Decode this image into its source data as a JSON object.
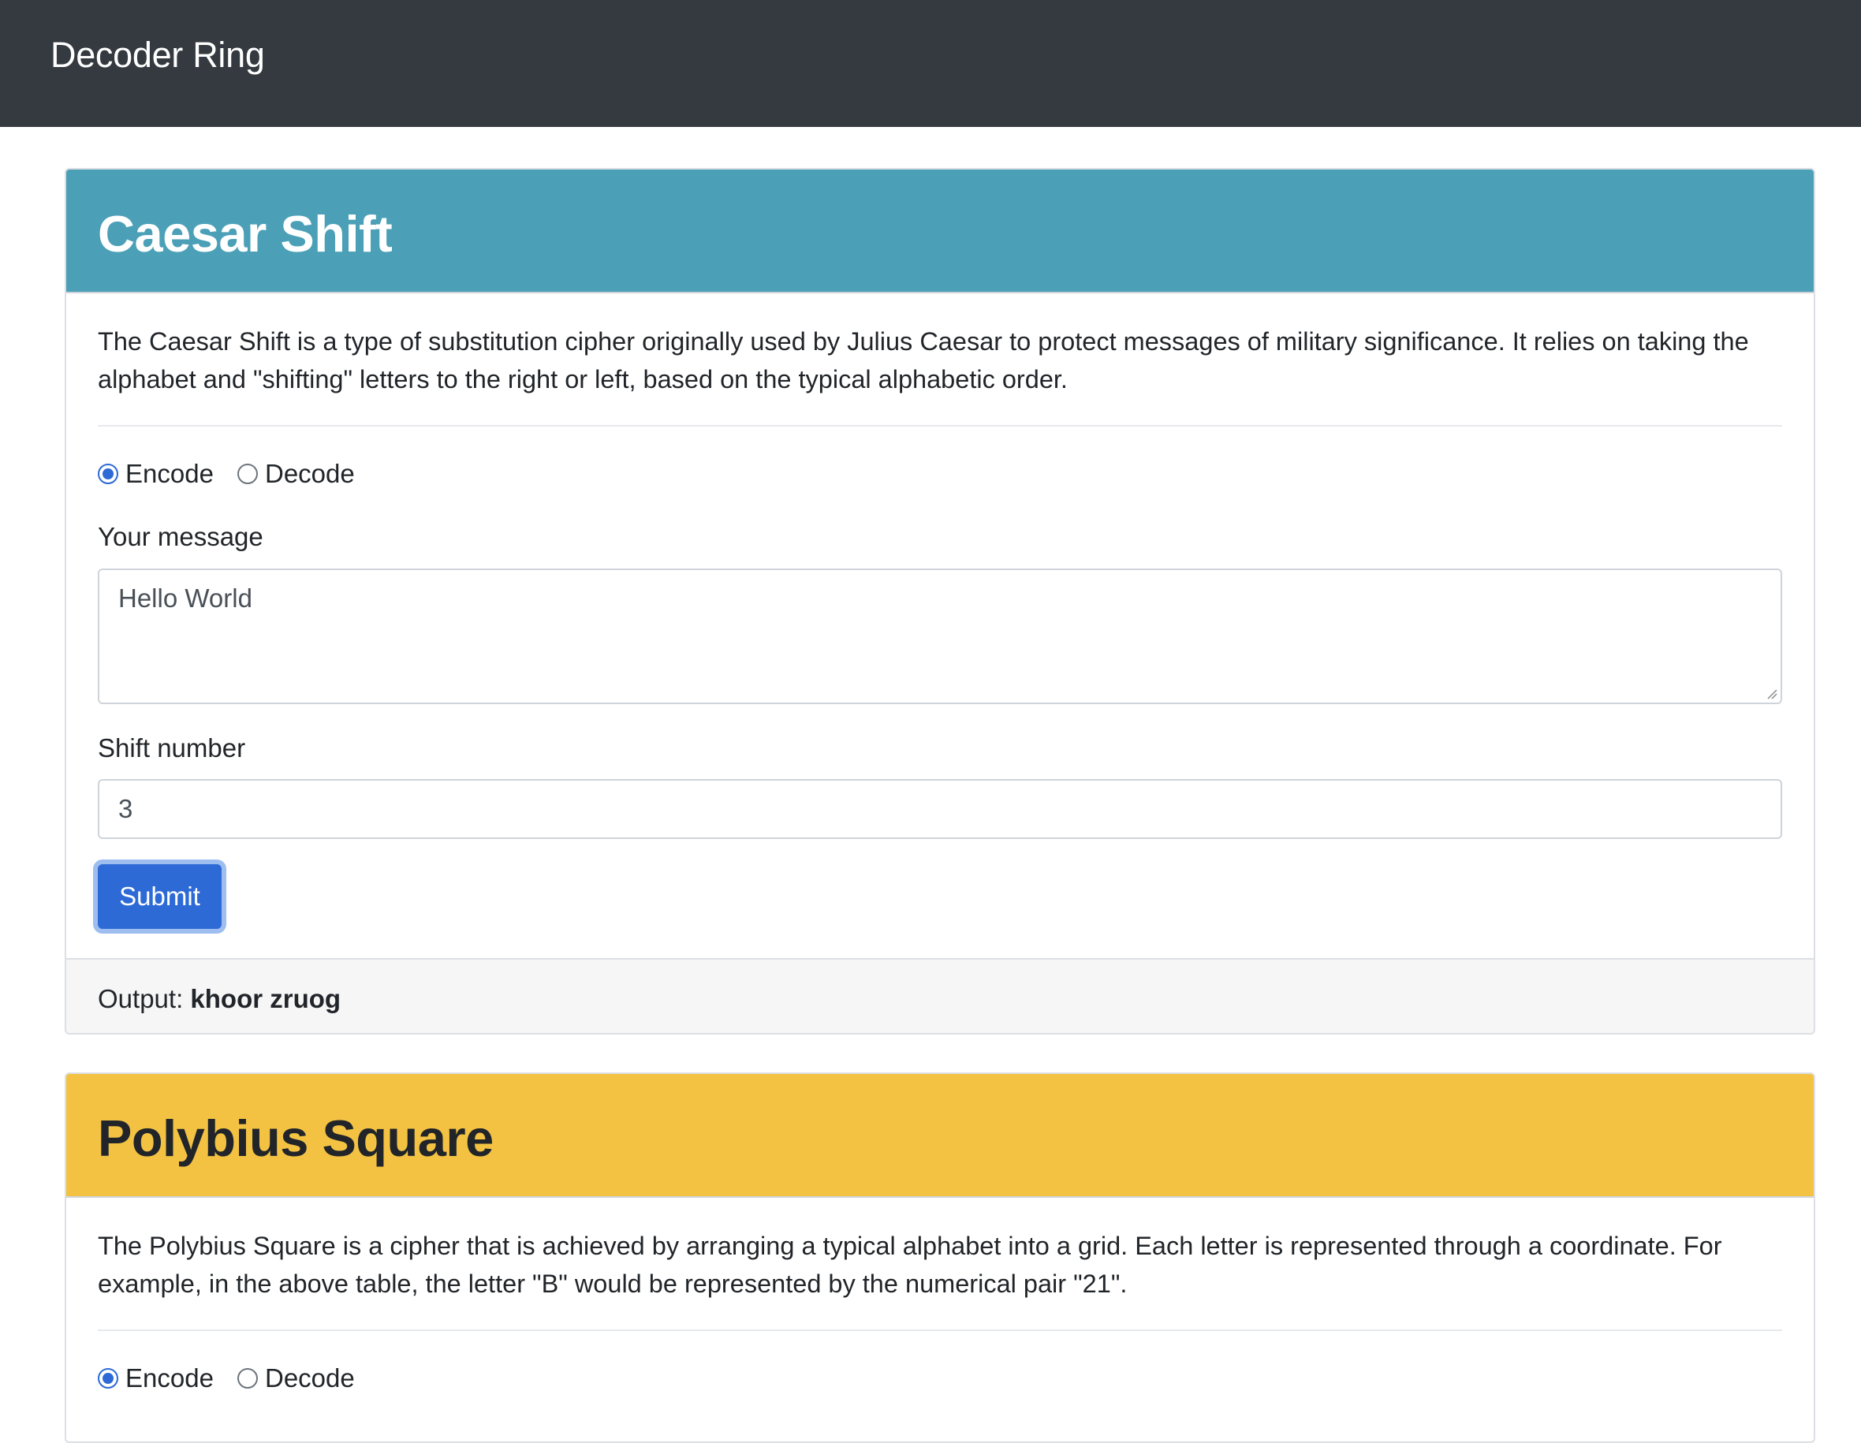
{
  "app": {
    "title": "Decoder Ring"
  },
  "caesar": {
    "title": "Caesar Shift",
    "description": "The Caesar Shift is a type of substitution cipher originally used by Julius Caesar to protect messages of military significance. It relies on taking the alphabet and \"shifting\" letters to the right or left, based on the typical alphabetic order.",
    "mode_options": [
      "Encode",
      "Decode"
    ],
    "selected_mode": "Encode",
    "message_label": "Your message",
    "message_value": "Hello World",
    "shift_label": "Shift number",
    "shift_value": "3",
    "submit_label": "Submit",
    "output_label": "Output:",
    "output_value": "khoor zruog"
  },
  "polybius": {
    "title": "Polybius Square",
    "description": "The Polybius Square is a cipher that is achieved by arranging a typical alphabet into a grid. Each letter is represented through a coordinate. For example, in the above table, the letter \"B\" would be represented by the numerical pair \"21\".",
    "mode_options": [
      "Encode",
      "Decode"
    ],
    "selected_mode": "Encode"
  },
  "colors": {
    "navbar": "#343a40",
    "caesar_header": "#4ba0b7",
    "polybius_header": "#f4c243",
    "primary": "#2d6ad6"
  }
}
